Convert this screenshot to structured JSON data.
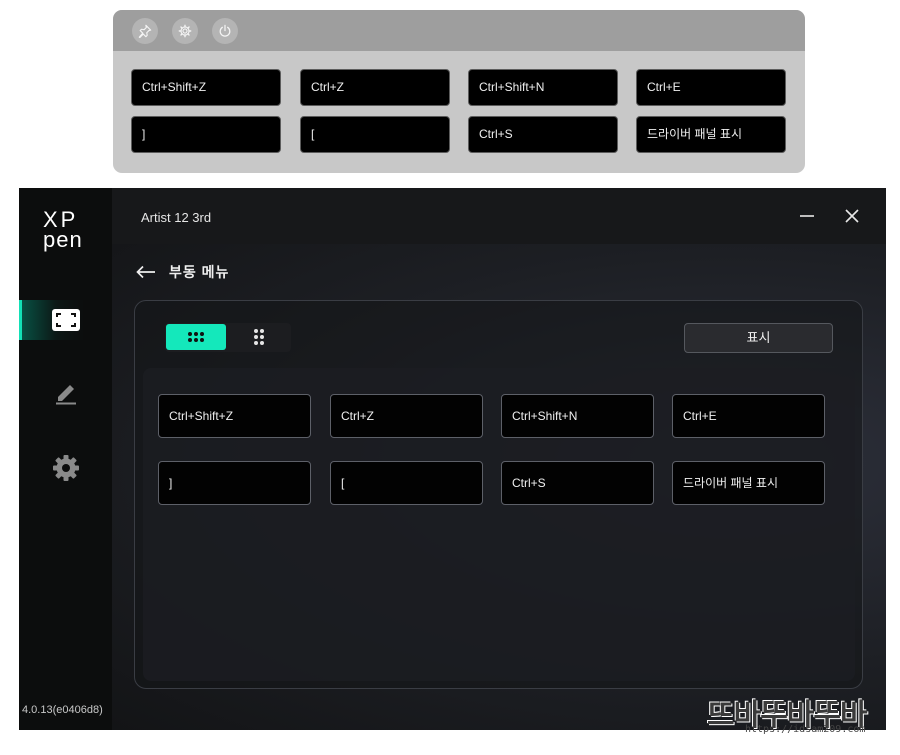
{
  "floating_panel": {
    "keys": [
      "Ctrl+Shift+Z",
      "Ctrl+Z",
      "Ctrl+Shift+N",
      "Ctrl+E",
      "]",
      "[",
      "Ctrl+S",
      "드라이버 패널 표시"
    ]
  },
  "app": {
    "logo_line1": "XP",
    "logo_line2": "pen",
    "version": "4.0.13(e0406d8)",
    "title": "Artist 12 3rd",
    "page_title": "부동 메뉴",
    "show_button": "표시",
    "keys": [
      "Ctrl+Shift+Z",
      "Ctrl+Z",
      "Ctrl+Shift+N",
      "Ctrl+E",
      "]",
      "[",
      "Ctrl+S",
      "드라이버 패널 표시"
    ],
    "accent_color": "#14e8bb"
  },
  "watermark": {
    "text": "뜨바뚜바뚜바",
    "url": "https://idsam209.com"
  },
  "icons": [
    "pin-icon",
    "gear-icon",
    "power-icon",
    "screen-icon",
    "pen-icon",
    "settings-icon",
    "minimize-icon",
    "close-icon",
    "back-arrow-icon",
    "grid-3x3-icon",
    "grid-2x3-icon"
  ]
}
